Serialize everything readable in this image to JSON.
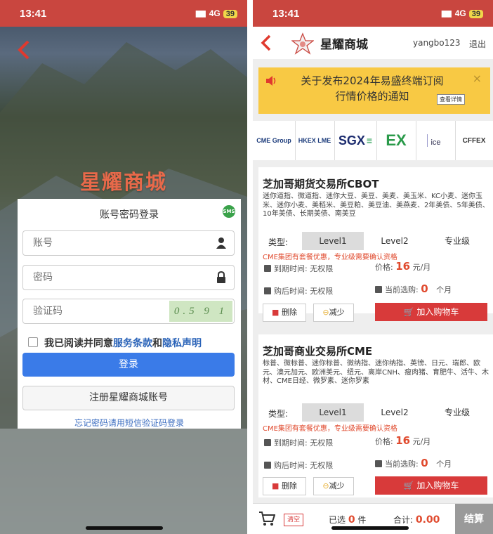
{
  "left": {
    "status": {
      "time": "13:41",
      "network": "4G",
      "battery": "39"
    },
    "brand": "星耀商城",
    "login_title": "账号密码登录",
    "sms_badge": "SMS",
    "account_placeholder": "账号",
    "password_placeholder": "密码",
    "captcha_placeholder": "验证码",
    "captcha_text": "0.5 9 1",
    "agree_prefix": "我已阅读并同意",
    "terms_link": "服务条款",
    "and_text": "和",
    "privacy_link": "隐私声明",
    "login_button": "登录",
    "register_button": "注册星耀商城账号",
    "forgot_link": "忘记密码请用短信验证码登录"
  },
  "right": {
    "status": {
      "time": "13:41",
      "network": "4G",
      "battery": "39"
    },
    "header": {
      "title": "星耀商城",
      "username": "yangbo123",
      "logout": "退出"
    },
    "notice": {
      "line1": "关于发布2024年易盛终端订阅",
      "line2": "行情价格的通知",
      "detail_button": "查看详情",
      "close": "×"
    },
    "exchanges": [
      "CME Group",
      "HKEX LME",
      "SGX",
      "EX",
      "ice",
      "CFFEX"
    ],
    "products": [
      {
        "title": "芝加哥期货交易所CBOT",
        "list": "迷你道指、微道指、迷你大豆、美豆、美麦、美玉米、KC小麦、迷你玉米、迷你小麦、美稻米、美豆粕、美豆油、美燕麦、2年美债、5年美债、10年美债、长期美债、南美豆",
        "type_label": "类型:",
        "tabs": [
          "Level1",
          "Level2",
          "专业级"
        ],
        "selected_tab": "Level1",
        "promo": "CME集团有套餐优惠，专业级需要确认资格",
        "expiry_label": "到期时间:",
        "expiry_value": "无权限",
        "price_label": "价格:",
        "price_value": "16",
        "price_unit": "元/月",
        "after_label": "购后时间:",
        "after_value": "无权限",
        "current_label": "当前选购:",
        "current_value": "0",
        "current_unit": "个月",
        "delete_button": "删除",
        "decrease_button": "减少",
        "add_button": "加入购物车"
      },
      {
        "title": "芝加哥商业交易所CME",
        "list": "标普、微标普、迷你标普、微纳指、迷你纳指、英镑、日元、瑞郎、欧元、澳元加元、欧洲美元、纽元、离岸CNH、瘦肉猪、育肥牛、活牛、木材、CME日经、微罗素、迷你罗素",
        "type_label": "类型:",
        "tabs": [
          "Level1",
          "Level2",
          "专业级"
        ],
        "selected_tab": "Level1",
        "promo": "CME集团有套餐优惠，专业级需要确认资格",
        "expiry_label": "到期时间:",
        "expiry_value": "无权限",
        "price_label": "价格:",
        "price_value": "16",
        "price_unit": "元/月",
        "after_label": "购后时间:",
        "after_value": "无权限",
        "current_label": "当前选购:",
        "current_value": "0",
        "current_unit": "个月",
        "delete_button": "删除",
        "decrease_button": "减少",
        "add_button": "加入购物车"
      }
    ],
    "cart": {
      "clear": "清空",
      "selected_prefix": "已选",
      "selected_count": "0",
      "selected_unit": "件",
      "total_label": "合计:",
      "total_value": "0.00",
      "checkout": "结算"
    }
  }
}
